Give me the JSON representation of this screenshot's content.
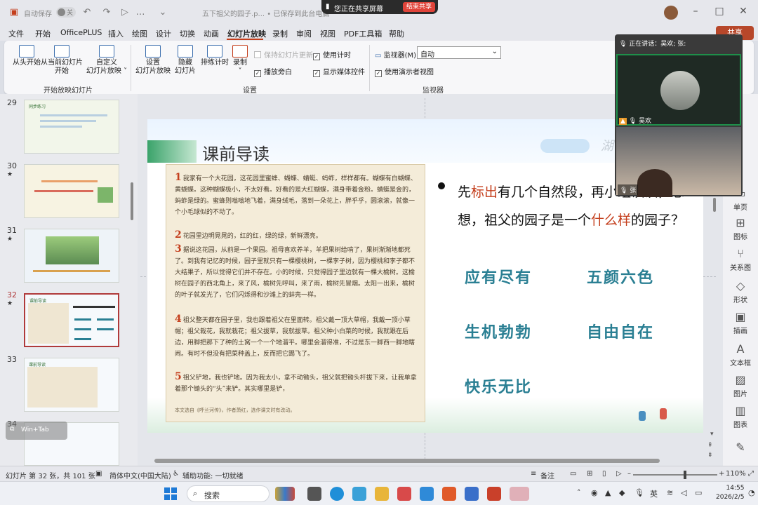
{
  "titlebar": {
    "autosave_label": "自动保存",
    "autosave_state": "关",
    "doc_title": "五下祖父的园子.p... • 已保存到此台电脑",
    "share_status": "您正在共享屏幕",
    "stop_share": "结束共享"
  },
  "menu": {
    "items": [
      "文件",
      "开始",
      "OfficePLUS",
      "插入",
      "绘图",
      "设计",
      "切换",
      "动画",
      "幻灯片放映",
      "录制",
      "审阅",
      "视图",
      "PDF工具箱",
      "帮助"
    ],
    "active_index": 8,
    "share_button": "共享"
  },
  "ribbon": {
    "start_group": {
      "buttons": [
        {
          "label1": "从头开始",
          "label2": ""
        },
        {
          "label1": "从当前幻灯片",
          "label2": "开始"
        },
        {
          "label1": "自定义",
          "label2": "幻灯片放映 ˅"
        }
      ],
      "group_label": "开始放映幻灯片"
    },
    "setup_group": {
      "buttons": [
        {
          "label1": "设置",
          "label2": "幻灯片放映"
        },
        {
          "label1": "隐藏",
          "label2": "幻灯片"
        },
        {
          "label1": "排练计时",
          "label2": ""
        },
        {
          "label1": "录制",
          "label2": "˅"
        }
      ],
      "checks": [
        {
          "label": "保持幻灯片更新",
          "checked": false,
          "disabled": true
        },
        {
          "label": "播放旁白",
          "checked": true,
          "disabled": false
        },
        {
          "label": "使用计时",
          "checked": true,
          "disabled": false
        },
        {
          "label": "显示媒体控件",
          "checked": true,
          "disabled": false
        }
      ],
      "group_label": "设置"
    },
    "monitor_group": {
      "monitor_label": "监视器(M):",
      "monitor_value": "自动",
      "presenter_view": "使用演示者视图",
      "group_label": "监视器"
    }
  },
  "thumbnails": [
    {
      "num": "29",
      "heading": "同步练习",
      "caption": "请你用横线画出…",
      "star": false
    },
    {
      "num": "30",
      "heading": "",
      "caption": "我有一个大花园…",
      "star": true
    },
    {
      "num": "31",
      "heading": "",
      "caption": "",
      "star": true
    },
    {
      "num": "32",
      "heading": "课前导读",
      "caption": "",
      "star": true,
      "selected": true
    },
    {
      "num": "33",
      "heading": "课前导读",
      "caption": "",
      "star": false
    },
    {
      "num": "34",
      "heading": "",
      "caption": "",
      "star": false
    }
  ],
  "float_chip": "Win+Tab",
  "slide": {
    "title": "课前导读",
    "corner_text": "湖",
    "paragraphs": [
      {
        "num": "1",
        "text": "我家有一个大花园，这花园里蜜蜂、蝴蝶、蜻蜓、蚂蚱，样样都有。蝴蝶有白蝴蝶、黄蝴蝶。这种蝴蝶极小，不太好看。好看的是大红蝴蝶，满身带着金粉。蜻蜓是金的，蚂蚱是绿的。蜜蜂则嗡嗡地飞着，满身绒毛，落到一朵花上，胖乎乎，圆滚滚，就像一个小毛球似的不动了。"
      },
      {
        "num": "2",
        "text": "花园里边明晃晃的，红的红，绿的绿，新鲜漂亮。"
      },
      {
        "num": "3",
        "text": "据说这花园，从前是一个果园。祖母喜欢养羊，羊把果树给啃了，果树渐渐地都死了。到我有记忆的时候，园子里就只有一棵樱桃树，一棵李子树，因为樱桃和李子都不大结果子，所以觉得它们并不存在。小的时候，只觉得园子里边就有一棵大榆树。这榆树在园子的西北角上，来了风，榆树先呼叫，来了雨，榆树先冒烟。太阳一出来，榆树的叶子就发光了，它们闪烁得和沙滩上的蚌壳一样。"
      },
      {
        "num": "4",
        "text": "祖父整天都在园子里，我也跟着祖父在里面转。祖父戴一顶大草帽，我戴一顶小草帽；祖父栽花，我就栽花；祖父拔草，我就拔草。祖父种小白菜的时候，我就跟在后边，用脚把那下了种的土窝一个一个地溜平。哪里会溜得准，不过是东一脚西一脚地瞎闹。有时不但没有把菜种盖上，反而把它踢飞了。"
      },
      {
        "num": "5",
        "text": "祖父铲地，我也铲地。因为我太小，拿不动锄头，祖父就把锄头杆拔下来，让我单拿着那个锄头的“头”来铲。其实哪里是铲，"
      }
    ],
    "source": "本文选自《呼兰河传》，作者萧红，选作课文时有改动。",
    "question_parts": [
      "先",
      "标出",
      "有几个自然段，再小组读读，",
      "想一想，祖父的园子是一个",
      "什么样",
      "的园子？"
    ],
    "idioms": [
      "应有尽有",
      "五颜六色",
      "生机勃勃",
      "自由自在",
      "快乐无比"
    ]
  },
  "right_panel": [
    {
      "icon": "▭",
      "label": "单页"
    },
    {
      "icon": "⊞",
      "label": "图标"
    },
    {
      "icon": "⑂",
      "label": "关系图"
    },
    {
      "icon": "◇",
      "label": "形状"
    },
    {
      "icon": "▣",
      "label": "插画"
    },
    {
      "icon": "A",
      "label": "文本框"
    },
    {
      "icon": "▨",
      "label": "图片"
    },
    {
      "icon": "▥",
      "label": "图表"
    }
  ],
  "meeting": {
    "speaking": "正在讲话：吴欢; 张:",
    "participant1": "吴欢",
    "participant2": "张"
  },
  "statusbar": {
    "slide_info": "幻灯片 第 32 张，共 101 张",
    "language": "简体中文(中国大陆)",
    "accessibility": "辅助功能: 一切就绪",
    "notes": "备注",
    "zoom": "110%"
  },
  "taskbar": {
    "search": "搜索",
    "ime": "英",
    "time": "14:55",
    "date": "2026/2/5"
  },
  "colors": {
    "accent": "#c43e1c",
    "idiom": "#2a7f93",
    "brand": "#b7472a"
  }
}
